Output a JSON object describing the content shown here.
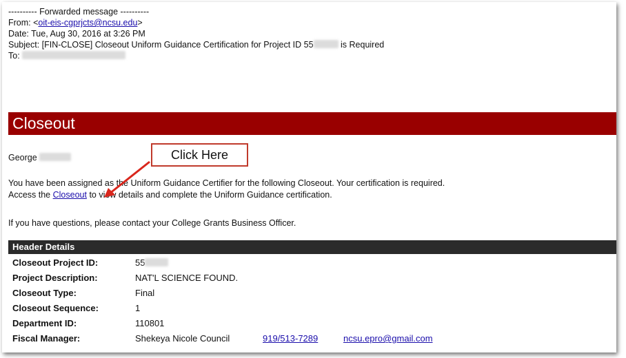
{
  "forwarded": {
    "divider": "---------- Forwarded message ----------",
    "from_label": "From: ",
    "from_email": "oit-eis-cgprjcts@ncsu.edu",
    "date": "Date: Tue, Aug 30, 2016 at 3:26 PM",
    "subject_prefix": "Subject: [FIN-CLOSE] Closeout Uniform Guidance Certification for Project ID 55",
    "subject_suffix": " is Required",
    "to_label": "To: "
  },
  "banner": {
    "title": "Closeout"
  },
  "message": {
    "greeting": "George",
    "line1": "You have been assigned as the Uniform Guidance Certifier for the following Closeout. Your certification is required.",
    "line2_prefix": "Access the ",
    "line2_link": "Closeout",
    "line2_suffix": " to view details and complete the Uniform Guidance certification.",
    "line3": "If you have questions, please contact your College Grants Business Officer."
  },
  "callout": {
    "label": "Click Here",
    "color": "#c0392b"
  },
  "header_details": {
    "title": "Header Details",
    "rows": [
      {
        "label": "Closeout Project ID:",
        "value": "55"
      },
      {
        "label": "Project Description:",
        "value": "NAT'L SCIENCE FOUND."
      },
      {
        "label": "Closeout Type:",
        "value": "Final"
      },
      {
        "label": "Closeout Sequence:",
        "value": "1"
      },
      {
        "label": "Department ID:",
        "value": "110801"
      },
      {
        "label": "Fiscal Manager:",
        "value": "Shekeya Nicole Council",
        "phone": "919/513-7289",
        "email": "ncsu.epro@gmail.com"
      }
    ]
  },
  "colors": {
    "banner": "#990000",
    "header_bar": "#2b2b2b",
    "link": "#1a0dab"
  }
}
